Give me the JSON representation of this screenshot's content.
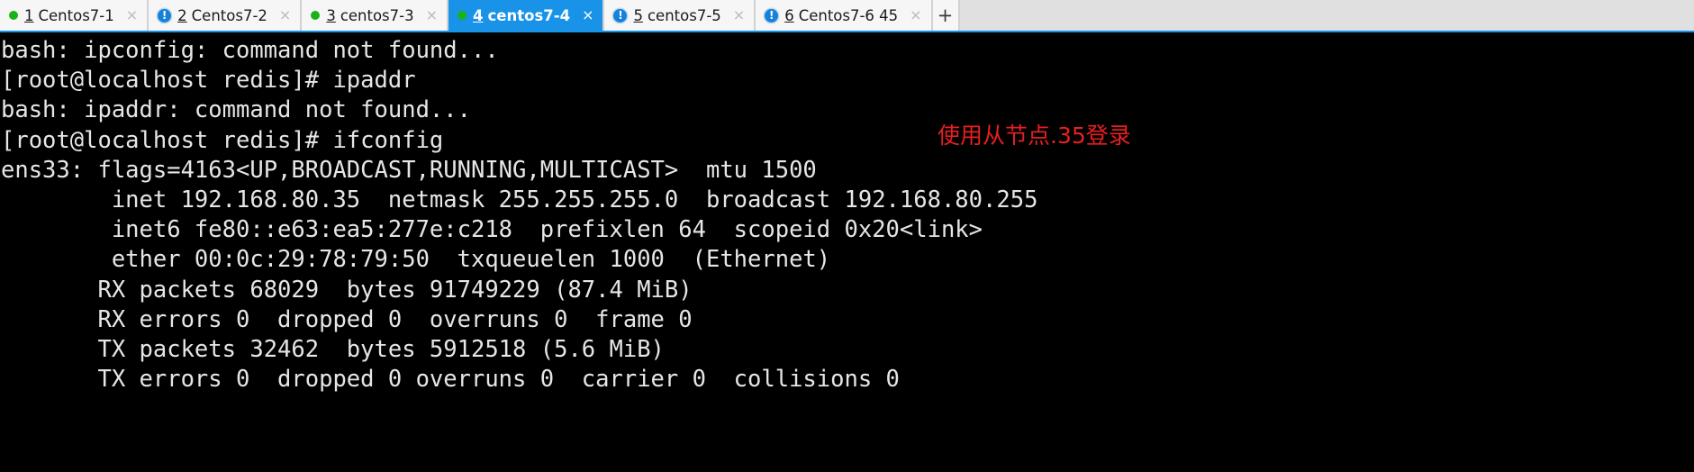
{
  "tabbar": {
    "tabs": [
      {
        "index": "1",
        "title": "Centos7-1",
        "status": "green",
        "status_icon": "green-dot-icon",
        "active": false,
        "close_label": "×"
      },
      {
        "index": "2",
        "title": "Centos7-2",
        "status": "alert",
        "status_icon": "blue-alert-icon",
        "active": false,
        "close_label": "×"
      },
      {
        "index": "3",
        "title": "centos7-3",
        "status": "green",
        "status_icon": "green-dot-icon",
        "active": false,
        "close_label": "×"
      },
      {
        "index": "4",
        "title": "centos7-4",
        "status": "green",
        "status_icon": "green-dot-icon",
        "active": true,
        "close_label": "×"
      },
      {
        "index": "5",
        "title": "centos7-5",
        "status": "alert",
        "status_icon": "blue-alert-icon",
        "active": false,
        "close_label": "×"
      },
      {
        "index": "6",
        "title": "Centos7-6 45",
        "status": "alert",
        "status_icon": "blue-alert-icon",
        "active": false,
        "close_label": "×"
      }
    ],
    "new_tab_label": "+",
    "active_tab_color": "#1893e8",
    "tab_background": "#f6f6f6",
    "bar_background": "#e0e0e0"
  },
  "terminal": {
    "background": "#000000",
    "foreground": "#e6e6e6",
    "lines": "bash: ipconfig: command not found...\n[root@localhost redis]# ipaddr\nbash: ipaddr: command not found...\n[root@localhost redis]# ifconfig\nens33: flags=4163<UP,BROADCAST,RUNNING,MULTICAST>  mtu 1500\n        inet 192.168.80.35  netmask 255.255.255.0  broadcast 192.168.80.255\n        inet6 fe80::e63:ea5:277e:c218  prefixlen 64  scopeid 0x20<link>\n        ether 00:0c:29:78:79:50  txqueuelen 1000  (Ethernet)\n       RX packets 68029  bytes 91749229 (87.4 MiB)\n       RX errors 0  dropped 0  overruns 0  frame 0\n       TX packets 32462  bytes 5912518 (5.6 MiB)\n       TX errors 0  dropped 0 overruns 0  carrier 0  collisions 0"
  },
  "annotation": {
    "text": "使用从节点.35登录",
    "color": "#e81f1f"
  }
}
